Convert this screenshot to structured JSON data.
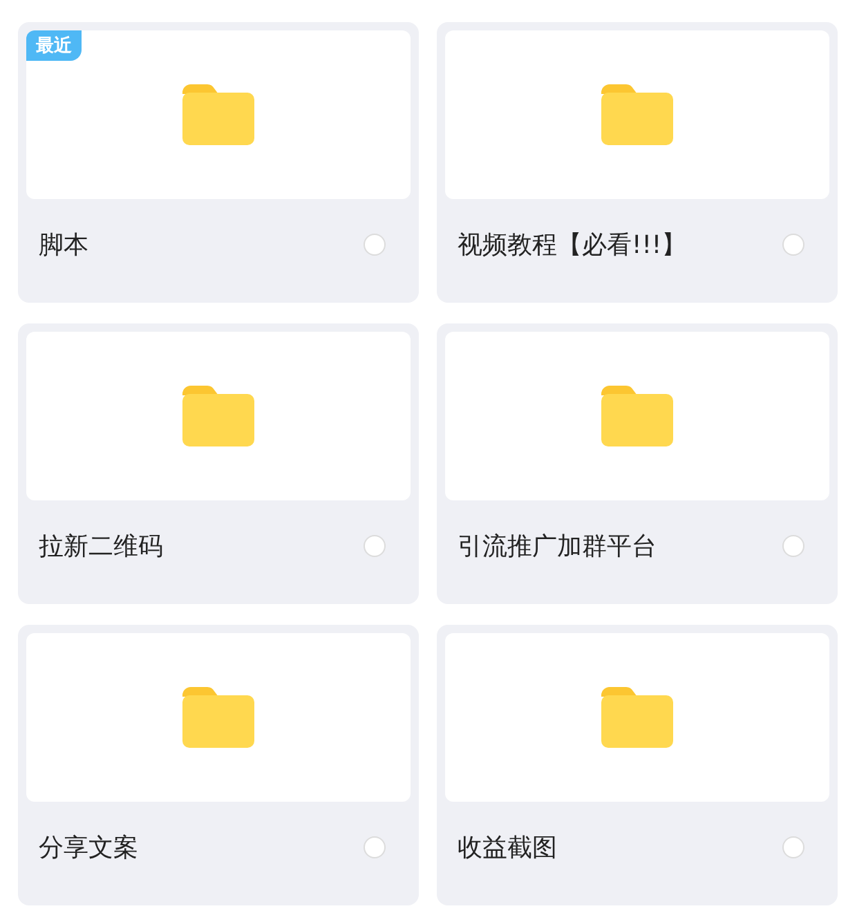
{
  "folders": [
    {
      "name": "脚本",
      "badge": "最近",
      "checked": false
    },
    {
      "name": "视频教程【必看!!!】",
      "checked": false
    },
    {
      "name": "拉新二维码",
      "checked": false
    },
    {
      "name": "引流推广加群平台",
      "checked": false
    },
    {
      "name": "分享文案",
      "checked": false
    },
    {
      "name": "收益截图",
      "checked": false
    }
  ]
}
